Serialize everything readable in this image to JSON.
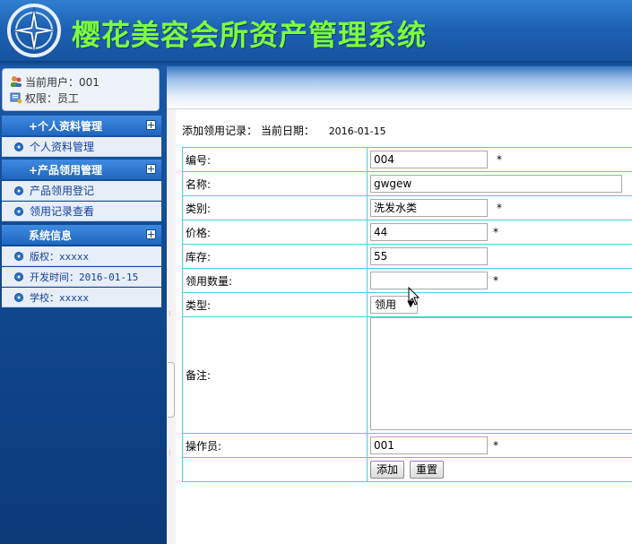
{
  "header": {
    "title": "樱花美容会所资产管理系统",
    "title_color": "#7dff3a",
    "bg_color": "#1e62b4"
  },
  "user": {
    "current_user_label": "当前用户：001",
    "permission_label": "权限：员工"
  },
  "menu": [
    {
      "heading": "+个人资料管理",
      "items": [
        "个人资料管理"
      ]
    },
    {
      "heading": "+产品领用管理",
      "items": [
        "产品领用登记",
        "领用记录查看"
      ]
    },
    {
      "heading": "系统信息",
      "items": [
        "版权：xxxxx",
        "开发时间：2016-01-15",
        "学校：xxxxx"
      ]
    }
  ],
  "form": {
    "caption": "添加领用记录：",
    "date_label": "当前日期：",
    "date_value": "2016-01-15",
    "border_color": "#48cfe0",
    "fields": {
      "code": {
        "label": "编号:",
        "value": "004",
        "required": "*"
      },
      "name": {
        "label": "名称:",
        "value": "gwgew"
      },
      "category": {
        "label": "类别:",
        "value": "洗发水类",
        "required": "*"
      },
      "price": {
        "label": "价格:",
        "value": "44",
        "required": "*"
      },
      "stock": {
        "label": "库存:",
        "value": "55"
      },
      "quantity": {
        "label": "领用数量:",
        "value": "",
        "required": "*"
      },
      "type": {
        "label": "类型:",
        "value": "领用"
      },
      "remark": {
        "label": "备注:",
        "value": ""
      },
      "operator": {
        "label": "操作员:",
        "value": "001",
        "required": "*"
      }
    },
    "buttons": {
      "add": "添加",
      "reset": "重置"
    }
  },
  "icons": [
    "logo-icon",
    "user-icon",
    "permission-icon",
    "expand-icon",
    "bullet-icon",
    "cursor-icon"
  ]
}
